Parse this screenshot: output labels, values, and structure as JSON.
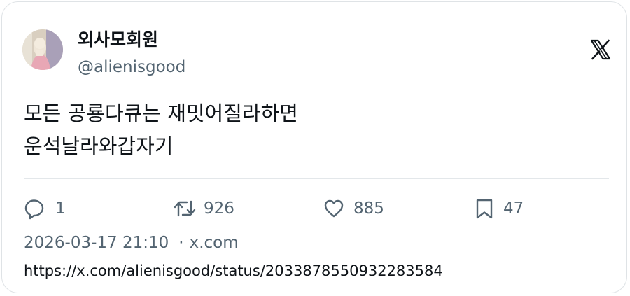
{
  "tweet": {
    "author": {
      "display_name": "외사모회원",
      "handle": "@alienisgood",
      "avatar_icon": "profile-photo"
    },
    "platform_logo": "x-logo",
    "text_lines": [
      "모든 공룡다큐는 재밋어질라하면",
      "운석날라와갑자기"
    ],
    "actions": {
      "reply": {
        "icon": "reply-bubble-icon",
        "count": "1"
      },
      "retweet": {
        "icon": "retweet-icon",
        "count": "926"
      },
      "like": {
        "icon": "heart-icon",
        "count": "885"
      },
      "bookmark": {
        "icon": "bookmark-icon",
        "count": "47"
      }
    },
    "timestamp": "2026-03-17 21:10",
    "separator": "·",
    "source": "x.com",
    "url": "https://x.com/alienisgood/status/2033878550932283584"
  },
  "colors": {
    "text_primary": "#0f1419",
    "text_secondary": "#536471",
    "border": "#dfe3e6"
  }
}
